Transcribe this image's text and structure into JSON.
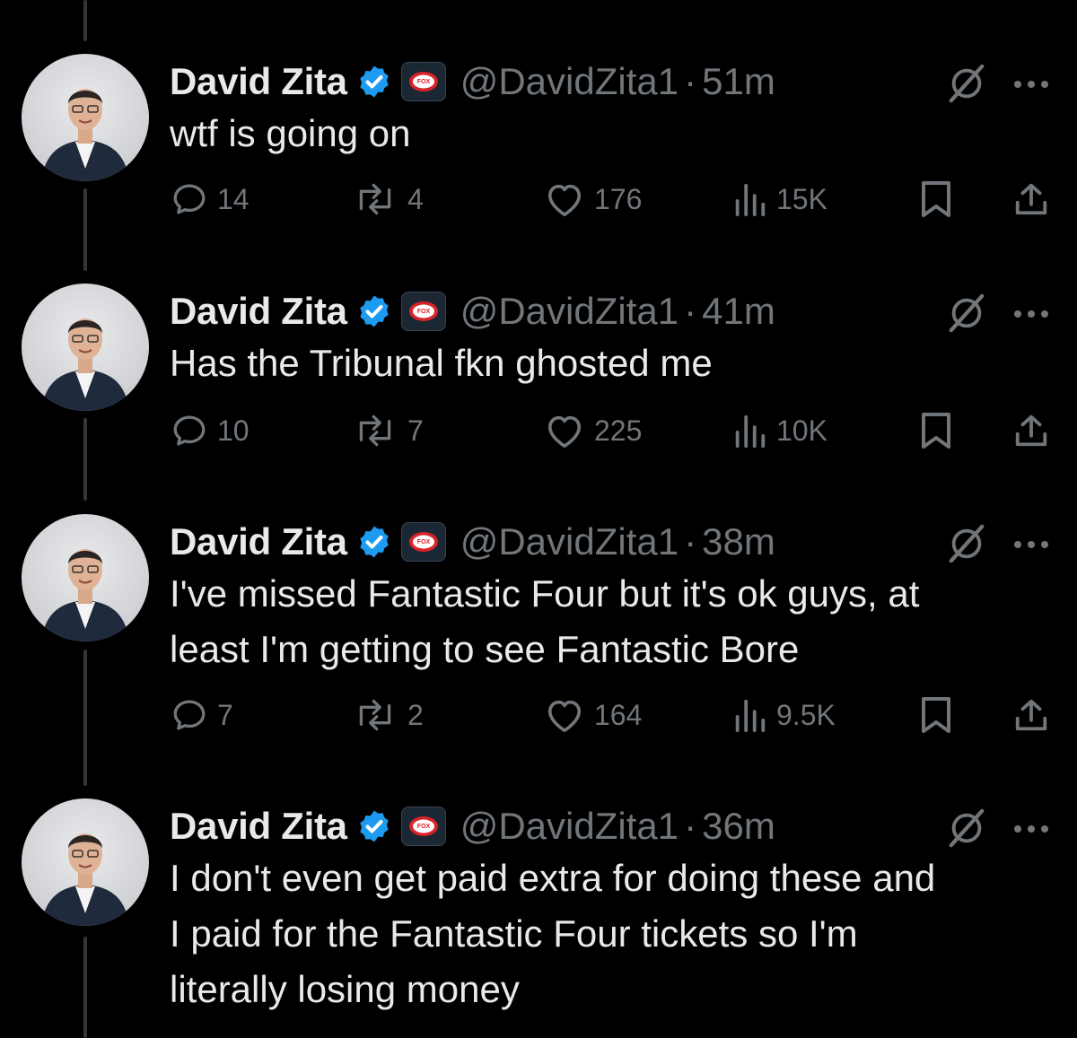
{
  "tweets": [
    {
      "name": "David Zita",
      "affiliate_badge": "FOX",
      "handle": "@DavidZita1",
      "separator": "·",
      "time": "51m",
      "lines": [
        "wtf is going on"
      ],
      "replies": "14",
      "reposts": "4",
      "likes": "176",
      "views": "15K"
    },
    {
      "name": "David Zita",
      "affiliate_badge": "FOX",
      "handle": "@DavidZita1",
      "separator": "·",
      "time": "41m",
      "lines": [
        "Has the Tribunal fkn ghosted me"
      ],
      "replies": "10",
      "reposts": "7",
      "likes": "225",
      "views": "10K"
    },
    {
      "name": "David Zita",
      "affiliate_badge": "FOX",
      "handle": "@DavidZita1",
      "separator": "·",
      "time": "38m",
      "lines": [
        "I've missed Fantastic Four but it's ok guys, at",
        "least I'm getting to see Fantastic Bore"
      ],
      "replies": "7",
      "reposts": "2",
      "likes": "164",
      "views": "9.5K"
    },
    {
      "name": "David Zita",
      "affiliate_badge": "FOX",
      "handle": "@DavidZita1",
      "separator": "·",
      "time": "36m",
      "lines": [
        "I don't even get paid extra for doing these and",
        "I paid for the Fantastic Four tickets so I'm",
        "literally losing money"
      ]
    }
  ],
  "colors": {
    "background": "#000000",
    "text_primary": "#e7e9ea",
    "text_secondary": "#71767b",
    "verified_blue": "#1d9bf0",
    "thread_line": "#333639"
  },
  "icons": [
    "verified-badge-icon",
    "fox-affiliate-icon",
    "grok-icon",
    "more-icon",
    "reply-icon",
    "repost-icon",
    "like-icon",
    "views-icon",
    "bookmark-icon",
    "share-icon"
  ]
}
